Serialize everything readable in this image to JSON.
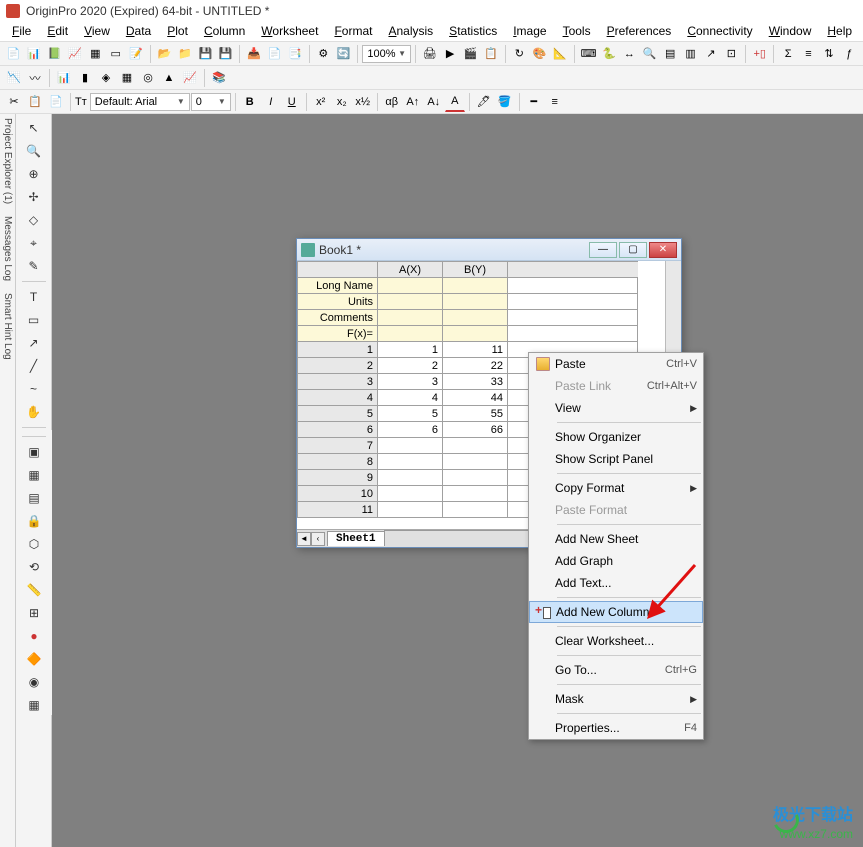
{
  "app": {
    "title": "OriginPro 2020 (Expired) 64-bit - UNTITLED *"
  },
  "menus": [
    "File",
    "Edit",
    "View",
    "Data",
    "Plot",
    "Column",
    "Worksheet",
    "Format",
    "Analysis",
    "Statistics",
    "Image",
    "Tools",
    "Preferences",
    "Connectivity",
    "Window",
    "Help"
  ],
  "toolbar": {
    "zoom": "100%",
    "font": "Default: Arial",
    "font_size": "0"
  },
  "left_panels": [
    "Project Explorer (1)",
    "Messages Log",
    "Smart Hint Log"
  ],
  "book": {
    "title": "Book1 *",
    "columns": [
      "A(X)",
      "B(Y)"
    ],
    "label_rows": [
      "Long Name",
      "Units",
      "Comments",
      "F(x)="
    ],
    "data": [
      {
        "row": 1,
        "a": 1,
        "b": 11
      },
      {
        "row": 2,
        "a": 2,
        "b": 22
      },
      {
        "row": 3,
        "a": 3,
        "b": 33
      },
      {
        "row": 4,
        "a": 4,
        "b": 44
      },
      {
        "row": 5,
        "a": 5,
        "b": 55
      },
      {
        "row": 6,
        "a": 6,
        "b": 66
      },
      {
        "row": 7,
        "a": "",
        "b": ""
      },
      {
        "row": 8,
        "a": "",
        "b": ""
      },
      {
        "row": 9,
        "a": "",
        "b": ""
      },
      {
        "row": 10,
        "a": "",
        "b": ""
      },
      {
        "row": 11,
        "a": "",
        "b": ""
      }
    ],
    "sheet_tab": "Sheet1"
  },
  "context_menu": {
    "paste": "Paste",
    "paste_sc": "Ctrl+V",
    "paste_link": "Paste Link",
    "paste_link_sc": "Ctrl+Alt+V",
    "view": "View",
    "show_organizer": "Show Organizer",
    "show_script": "Show Script Panel",
    "copy_format": "Copy Format",
    "paste_format": "Paste Format",
    "add_sheet": "Add New Sheet",
    "add_graph": "Add Graph",
    "add_text": "Add Text...",
    "add_column": "Add New Column",
    "clear_ws": "Clear Worksheet...",
    "goto": "Go To...",
    "goto_sc": "Ctrl+G",
    "mask": "Mask",
    "properties": "Properties...",
    "properties_sc": "F4"
  },
  "watermark": {
    "line1": "极光下载站",
    "line2": "www.xz7.com"
  }
}
